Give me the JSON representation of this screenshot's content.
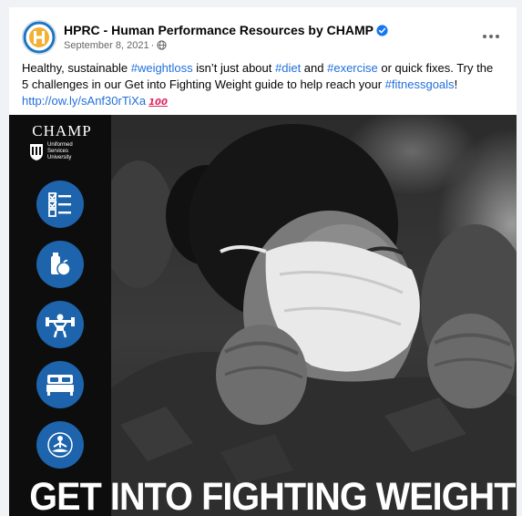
{
  "post": {
    "page_name": "HPRC - Human Performance Resources by CHAMP",
    "date": "September 8, 2021",
    "separator": "·",
    "text_segments": [
      {
        "type": "text",
        "value": "Healthy, sustainable "
      },
      {
        "type": "link",
        "value": "#weightloss"
      },
      {
        "type": "text",
        "value": " isn’t just about "
      },
      {
        "type": "link",
        "value": "#diet"
      },
      {
        "type": "text",
        "value": " and "
      },
      {
        "type": "link",
        "value": "#exercise"
      },
      {
        "type": "text",
        "value": " or quick fixes. Try the 5 challenges in our Get into Fighting Weight guide to help reach your "
      },
      {
        "type": "link",
        "value": "#fitnessgoals"
      },
      {
        "type": "text",
        "value": "! "
      },
      {
        "type": "link",
        "value": "http://ow.ly/sAnf30rTiXa"
      }
    ],
    "emoji": "100"
  },
  "graphic": {
    "logo_word": "CHAMP",
    "university_lines": [
      "Uniformed",
      "Services",
      "University"
    ],
    "icons": [
      "checklist-icon",
      "nutrition-icon",
      "weightlifting-icon",
      "sleep-icon",
      "meditation-icon"
    ],
    "headline": "GET INTO FIGHTING WEIGHT"
  },
  "colors": {
    "link": "#216fdb",
    "icon_circle": "#1d64ac",
    "avatar_ring": "#1b76c2",
    "avatar_fill": "#f2b134"
  }
}
